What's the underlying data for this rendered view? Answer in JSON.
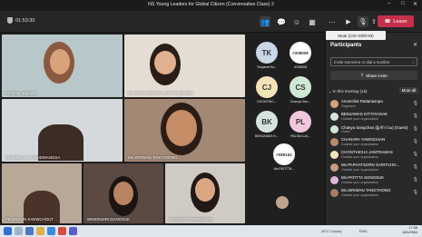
{
  "window": {
    "title": "NS Young Leaders for Global Citizen (Conversation Class) 2"
  },
  "toolbar": {
    "timer": "01:53:30",
    "leave_label": "Leave",
    "mute_tooltip": "Mute (Ctrl+Shift+M)"
  },
  "video_tiles": [
    {
      "name": "Pornthip Supeath"
    },
    {
      "name": "Ms.PAPHATSORN SARITCHOMBAT"
    },
    {
      "name": "PLOYBALIS YUNUDWANGSA"
    },
    {
      "name": "Ms.SIRIWAN TANGTHONG"
    },
    {
      "name": "PRAIRAVIN KAEWCHOUT"
    },
    {
      "name": "WIMONSIRI DANGSUK"
    },
    {
      "name": "CHANAPA YAWINCHAN"
    }
  ],
  "avatars": [
    {
      "initials": "TK",
      "name": "Tanyarat Ka...",
      "color": "#c9d8e6"
    },
    {
      "initials": "#208508",
      "name": "#208508",
      "color": "#ffffff"
    },
    {
      "initials": "CJ",
      "name": "CHONTHIC...",
      "color": "#f3e3b8"
    },
    {
      "initials": "CS",
      "name": "Chanya San...",
      "color": "#cfe8d4"
    },
    {
      "initials": "BK",
      "name": "BENJAMAS K...",
      "color": "#d6e4df"
    },
    {
      "initials": "PL",
      "name": "PALIDA LAI...",
      "color": "#f1c7dd"
    },
    {
      "initials": "#089162",
      "name": "Ms.PATITTA...",
      "color": "#ffffff"
    }
  ],
  "panel": {
    "title": "Participants",
    "invite_placeholder": "Invite someone or dial a number",
    "share_label": "Share invite",
    "in_meeting": "In this meeting (15)",
    "mute_all": "Mute all",
    "participants": [
      {
        "name": "Amonchai Rattanasopa",
        "role": "Organizer",
        "color": "#d8a27a"
      },
      {
        "name": "BENJAMAS KITTAYANAK",
        "role": "Outside your organization",
        "color": "#d6e4df"
      },
      {
        "name": "Chanya Sangchan (ผู้เข้าร่วม) (Guest)",
        "role": "Guest",
        "color": "#cfe8d4"
      },
      {
        "name": "CHANAPA YAWINCHAN",
        "role": "Outside your organization",
        "color": "#b98a6a"
      },
      {
        "name": "CHONTHICHA JANTRAMAS",
        "role": "Outside your organization",
        "color": "#f3e3b8"
      },
      {
        "name": "Ms.PAPHATSORN SARITCHO...",
        "role": "Outside your organization",
        "color": "#c59b7e"
      },
      {
        "name": "Ms.PATITTA SONGSUK",
        "role": "Outside your organization",
        "color": "#e0b6d9"
      },
      {
        "name": "Ms.SIRIWAN TANGTHONG",
        "role": "Outside your organization",
        "color": "#aa7c61"
      }
    ]
  },
  "taskbar": {
    "weather": "26°C Cloudy",
    "tray": "ENG",
    "time": "17:58",
    "date": "18/6/2564"
  }
}
